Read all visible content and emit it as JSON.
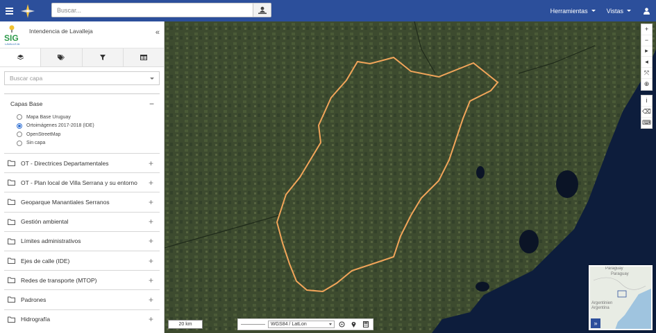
{
  "app": {
    "title": "Intendencia de Lavalleja",
    "logo_text": "SIG",
    "logo_subtext": "LAVALLEJA"
  },
  "header": {
    "search_placeholder": "Buscar...",
    "menus": [
      {
        "label": "Herramientas"
      },
      {
        "label": "Vistas"
      }
    ]
  },
  "sidebar": {
    "tabs": [
      {
        "icon": "layers-icon",
        "active": true
      },
      {
        "icon": "tags-icon",
        "active": false
      },
      {
        "icon": "filter-icon",
        "active": false
      },
      {
        "icon": "table-icon",
        "active": false
      }
    ],
    "layer_search_placeholder": "Buscar capa",
    "base_group": {
      "title": "Capas Base",
      "options": [
        {
          "label": "Mapa Base Uruguay",
          "selected": false
        },
        {
          "label": "Ortoimágenes 2017-2018 (IDE)",
          "selected": true
        },
        {
          "label": "OpenStreetMap",
          "selected": false
        },
        {
          "label": "Sin capa",
          "selected": false
        }
      ]
    },
    "groups": [
      {
        "label": "OT - Directrices Departamentales"
      },
      {
        "label": "OT - Plan local de Villa Serrana y su entorno"
      },
      {
        "label": "Geoparque Manantiales Serranos"
      },
      {
        "label": "Gestión ambiental"
      },
      {
        "label": "Límites administrativos"
      },
      {
        "label": "Ejes de calle (IDE)"
      },
      {
        "label": "Redes de transporte (MTOP)"
      },
      {
        "label": "Padrones"
      },
      {
        "label": "Hidrografía"
      }
    ]
  },
  "map": {
    "scale_label": "20 km",
    "crs_label": "WGS84 / LatLon",
    "overview_labels": {
      "paraguay": "Paraguay",
      "argentina": "Argentinien",
      "argentina_short": "Argentina"
    },
    "overview_expand": "»",
    "colors": {
      "boundary": "#f2a55a",
      "sea": "#0d1d3c",
      "land": "#3b4a2c",
      "header": "#2c4f9b"
    }
  }
}
